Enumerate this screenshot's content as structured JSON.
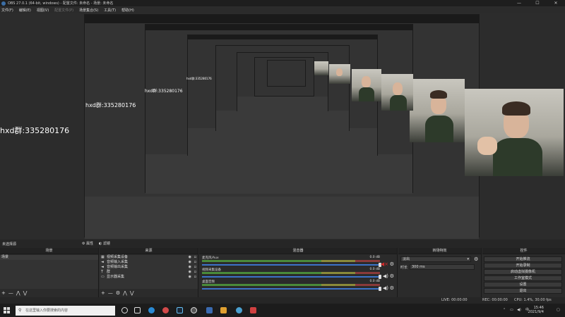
{
  "window": {
    "title": "OBS 27.0.1 (64-bit, windows) - 配置文件: 未命名 - 场景: 未命名",
    "minimize": "—",
    "maximize": "☐",
    "close": "✕"
  },
  "menu": [
    {
      "label": "文件(F)",
      "disabled": false
    },
    {
      "label": "编辑(E)",
      "disabled": false
    },
    {
      "label": "视图(V)",
      "disabled": false
    },
    {
      "label": "配置文件(P)",
      "disabled": true
    },
    {
      "label": "场景集合(S)",
      "disabled": false
    },
    {
      "label": "工具(T)",
      "disabled": false
    },
    {
      "label": "帮助(H)",
      "disabled": false
    }
  ],
  "preview": {
    "overlay_text": "hxd群:335280176"
  },
  "dock": {
    "scene_label": "未选择源",
    "properties_label": "属性",
    "filters_label": "滤镜"
  },
  "scenes": {
    "title": "场景",
    "items": [
      "场景"
    ],
    "footer": [
      "+",
      "—",
      "⋀",
      "⋁"
    ]
  },
  "sources": {
    "title": "来源",
    "items": [
      {
        "icon": "▦",
        "label": "视频采集设备"
      },
      {
        "icon": "◄",
        "label": "音频输入采集"
      },
      {
        "icon": "◄",
        "label": "音频输出采集"
      },
      {
        "icon": "T",
        "label": "群"
      },
      {
        "icon": "▭",
        "label": "显示器采集"
      }
    ],
    "footer": [
      "+",
      "—",
      "⚙",
      "⋀",
      "⋁"
    ]
  },
  "mixer": {
    "title": "混音器",
    "channels": [
      {
        "name": "麦克风/Aux",
        "db": "0.0 dB"
      },
      {
        "name": "视频采集设备",
        "db": "0.0 dB"
      },
      {
        "name": "桌面音频",
        "db": "0.0 dB"
      }
    ]
  },
  "transitions": {
    "title": "转场特效",
    "selected": "淡出",
    "duration_label": "时长",
    "duration_value": "300 ms"
  },
  "controls": {
    "title": "控件",
    "buttons": [
      "开始推流",
      "开始录制",
      "启动虚拟摄像机",
      "工作室模式",
      "设置",
      "退出"
    ]
  },
  "status": {
    "live": "LIVE: 00:00:00",
    "rec": "REC: 00:00:00",
    "cpu": "CPU: 1.4%, 30.00 fps"
  },
  "taskbar": {
    "search_placeholder": "在这里输入你要搜索的内容",
    "time": "15:46",
    "date": "2021/9/4",
    "tray_lang": "中"
  },
  "colors": {
    "background": "#2b2b2b",
    "panel": "#333333",
    "accent_blue": "#3c72c8",
    "meter_green": "#4a8a3a",
    "meter_yellow": "#8a8a3a",
    "meter_red": "#8a3a3a",
    "mute_red": "#d22b2b"
  }
}
